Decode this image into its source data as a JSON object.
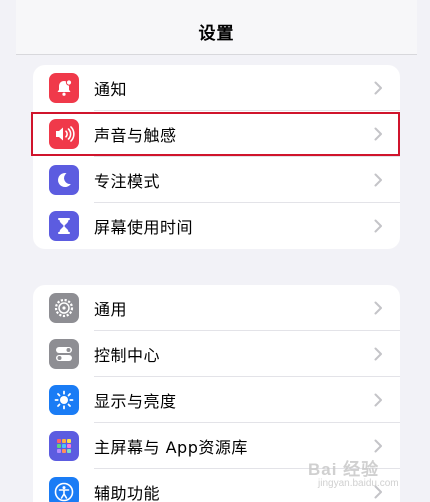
{
  "header": {
    "title": "设置"
  },
  "group1": [
    {
      "label": "通知",
      "icon": "bell-icon",
      "color": "#f0394a"
    },
    {
      "label": "声音与触感",
      "icon": "speaker-icon",
      "color": "#f0394a"
    },
    {
      "label": "专注模式",
      "icon": "moon-icon",
      "color": "#5c5ce0"
    },
    {
      "label": "屏幕使用时间",
      "icon": "hourglass-icon",
      "color": "#5c5ce0"
    }
  ],
  "group2": [
    {
      "label": "通用",
      "icon": "gear-icon",
      "color": "#8e8e93"
    },
    {
      "label": "控制中心",
      "icon": "toggles-icon",
      "color": "#8e8e93"
    },
    {
      "label": "显示与亮度",
      "icon": "sun-icon",
      "color": "#1a7cf5"
    },
    {
      "label": "主屏幕与 App资源库",
      "icon": "app-grid-icon",
      "color": "#5c5ce0"
    },
    {
      "label": "辅助功能",
      "icon": "accessibility-icon",
      "color": "#1a7cf5"
    }
  ],
  "watermark": {
    "text": "Bai 经验",
    "sub": "jingyan.baidu.com"
  }
}
